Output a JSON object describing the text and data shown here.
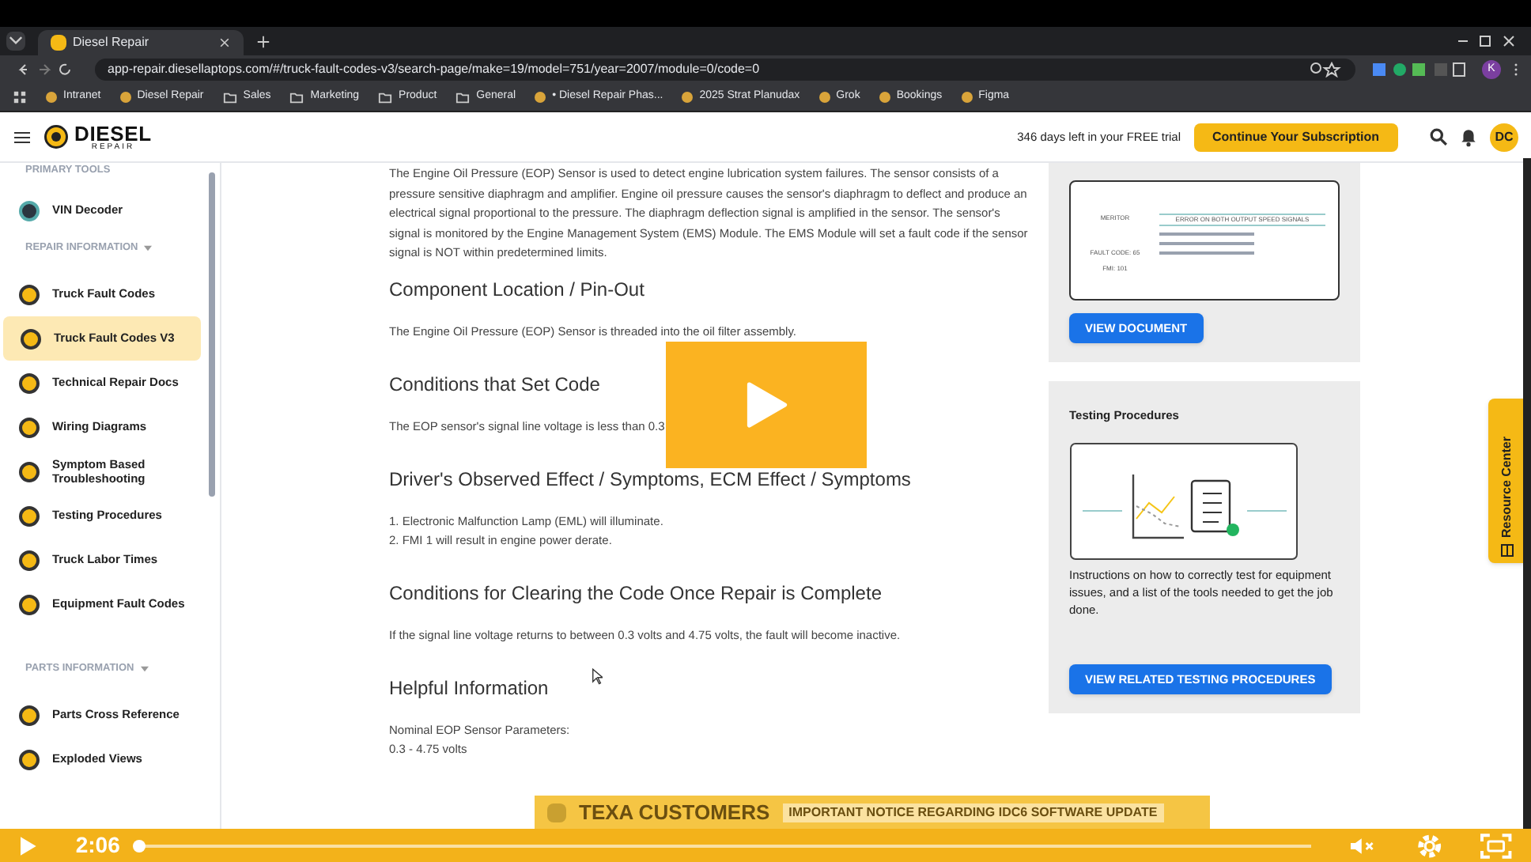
{
  "browser": {
    "tab_title": "Diesel Repair",
    "url": "app-repair.diesellaptops.com/#/truck-fault-codes-v3/search-page/make=19/model=751/year=2007/module=0/code=0",
    "profile": "K",
    "bookmarks": [
      {
        "label": "Intranet",
        "kind": "page"
      },
      {
        "label": "Diesel Repair",
        "kind": "page"
      },
      {
        "label": "Sales",
        "kind": "folder"
      },
      {
        "label": "Marketing",
        "kind": "folder"
      },
      {
        "label": "Product",
        "kind": "folder"
      },
      {
        "label": "General",
        "kind": "folder"
      },
      {
        "label": "• Diesel Repair Phas...",
        "kind": "page"
      },
      {
        "label": "2025 Strat Planudax",
        "kind": "page"
      },
      {
        "label": "Grok",
        "kind": "page"
      },
      {
        "label": "Bookings",
        "kind": "page"
      },
      {
        "label": "Figma",
        "kind": "page"
      }
    ]
  },
  "header": {
    "logo_word": "DIESEL",
    "logo_sub": "REPAIR",
    "trial_text": "346 days left in your FREE trial",
    "subscribe_button": "Continue Your Subscription",
    "avatar": "DC"
  },
  "sidebar": {
    "sections": [
      {
        "title": "PRIMARY TOOLS",
        "collapsible": false,
        "items": [
          {
            "label": "VIN Decoder",
            "selected": false
          }
        ]
      },
      {
        "title": "REPAIR INFORMATION",
        "collapsible": true,
        "items": [
          {
            "label": "Truck Fault Codes",
            "selected": false
          },
          {
            "label": "Truck Fault Codes V3",
            "selected": true
          },
          {
            "label": "Technical Repair Docs",
            "selected": false
          },
          {
            "label": "Wiring Diagrams",
            "selected": false
          },
          {
            "label": "Symptom Based Troubleshooting",
            "selected": false
          },
          {
            "label": "Testing Procedures",
            "selected": false
          },
          {
            "label": "Truck Labor Times",
            "selected": false
          },
          {
            "label": "Equipment Fault Codes",
            "selected": false
          }
        ]
      },
      {
        "title": "PARTS INFORMATION",
        "collapsible": true,
        "items": [
          {
            "label": "Parts Cross Reference",
            "selected": false
          },
          {
            "label": "Exploded Views",
            "selected": false
          }
        ]
      }
    ]
  },
  "content": {
    "intro": "The Engine Oil Pressure (EOP) Sensor is used to detect engine lubrication system failures. The sensor consists of a pressure sensitive diaphragm and amplifier. Engine oil pressure causes the sensor's diaphragm to deflect and produce an electrical signal proportional to the pressure. The diaphragm deflection signal is amplified in the sensor. The sensor's signal is monitored by the Engine Management System (EMS) Module. The EMS Module will set a fault code if the sensor signal is NOT within predetermined limits.",
    "sections": [
      {
        "heading": "Component Location / Pin-Out",
        "lines": [
          "The Engine Oil Pressure (EOP) Sensor is threaded into the oil filter assembly."
        ]
      },
      {
        "heading": "Conditions that Set Code",
        "lines": [
          "The EOP sensor's signal line voltage is less than 0.3"
        ]
      },
      {
        "heading": "Driver's Observed Effect / Symptoms, ECM Effect / Symptoms",
        "lines": [
          "1. Electronic Malfunction Lamp (EML) will illuminate.",
          "2. FMI 1 will result in engine power derate."
        ]
      },
      {
        "heading": "Conditions for Clearing the Code Once Repair is Complete",
        "lines": [
          "If the signal line voltage returns to between 0.3 volts and 4.75 volts, the fault will become inactive."
        ]
      },
      {
        "heading": "Helpful Information",
        "lines": [
          "Nominal EOP Sensor Parameters:",
          "0.3 - 4.75 volts"
        ]
      }
    ]
  },
  "document_card": {
    "thumbnail": {
      "make": "MERITOR",
      "fault_code": "FAULT CODE: 65",
      "fmi": "FMI: 101",
      "title": "ERROR ON BOTH OUTPUT SPEED SIGNALS"
    },
    "button": "VIEW DOCUMENT"
  },
  "testing_card": {
    "title": "Testing Procedures",
    "description": "Instructions on how to correctly test for equipment issues, and a list of the tools needed to get the job done.",
    "button": "VIEW RELATED TESTING PROCEDURES"
  },
  "resource_center": "Resource Center",
  "banner": {
    "title": "TEXA CUSTOMERS",
    "notice": "IMPORTANT NOTICE REGARDING IDC6 SOFTWARE UPDATE"
  },
  "video": {
    "time": "2:06",
    "level": 0.0
  }
}
